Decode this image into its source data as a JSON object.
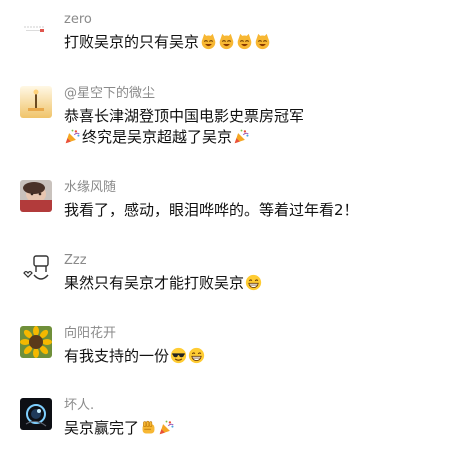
{
  "comments": [
    {
      "name": "zero",
      "text": "打败吴京的只有吴京",
      "emojis": [
        "cat-icon",
        "cat-icon",
        "cat-icon",
        "cat-icon"
      ]
    },
    {
      "name": "@星空下的微尘",
      "line1": "恭喜长津湖登顶中国电影史票房冠军",
      "line2": "终究是吴京超越了吴京",
      "emojis_before": [
        "party-popper-icon"
      ],
      "emojis_after": [
        "party-popper-icon"
      ]
    },
    {
      "name": "水缘风随",
      "text": "我看了，感动，眼泪哗哗的。等着过年看2！"
    },
    {
      "name": "Zzz",
      "text": "果然只有吴京才能打败吴京",
      "emojis": [
        "grin-icon"
      ]
    },
    {
      "name": "向阳花开",
      "text": "有我支持的一份",
      "emojis": [
        "sunglasses-icon",
        "grin-icon"
      ]
    },
    {
      "name": "坏人.",
      "text": "吴京赢完了",
      "emojis": [
        "fist-icon",
        "party-popper-icon"
      ]
    }
  ]
}
